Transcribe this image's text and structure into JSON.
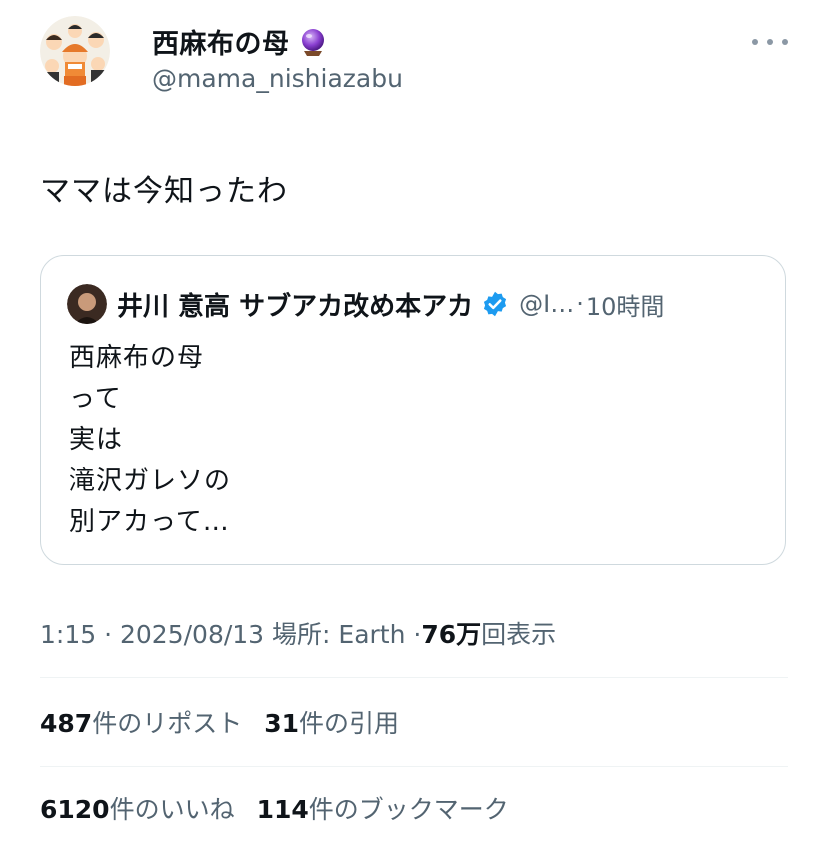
{
  "author": {
    "display_name": "西麻布の母",
    "emoji_icon": "crystal-ball",
    "handle": "@mama_nishiazabu"
  },
  "tweet": {
    "text": "ママは今知ったわ"
  },
  "quote": {
    "author_name": "井川 意高 サブアカ改め本アカ",
    "verified": true,
    "handle": "@I…",
    "separator": "·",
    "time": "10時間",
    "lines": [
      "西麻布の母",
      "って",
      "実は",
      "滝沢ガレソの",
      "別アカって…"
    ]
  },
  "meta": {
    "time": "1:15",
    "date": "2025/08/13",
    "location_label": "場所: Earth",
    "views_count": "76万",
    "views_label": "回表示",
    "sep": "·"
  },
  "stats": {
    "reposts_count": "487",
    "reposts_label": "件のリポスト",
    "quotes_count": "31",
    "quotes_label": "件の引用",
    "likes_count": "6120",
    "likes_label": "件のいいね",
    "bookmarks_count": "114",
    "bookmarks_label": "件のブックマーク"
  },
  "colors": {
    "text_primary": "#0f1419",
    "text_secondary": "#536471",
    "border": "#cfd9de",
    "verified_blue": "#1d9bf0"
  }
}
